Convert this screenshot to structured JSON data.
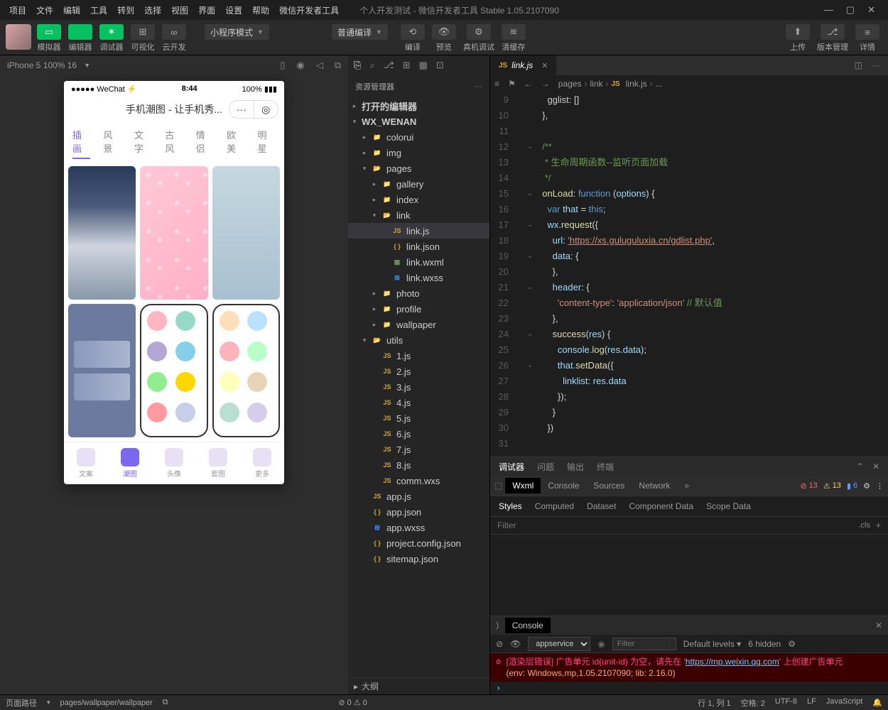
{
  "menu": [
    "项目",
    "文件",
    "编辑",
    "工具",
    "转到",
    "选择",
    "视图",
    "界面",
    "设置",
    "帮助",
    "微信开发者工具"
  ],
  "windowTitle": "个人开发测试 - 微信开发者工具 Stable 1.05.2107090",
  "toolbar": {
    "left": [
      {
        "icon": "▭",
        "label": "模拟器",
        "cls": "green"
      },
      {
        "icon": "</>",
        "label": "编辑器",
        "cls": "green"
      },
      {
        "icon": "✶",
        "label": "调试器",
        "cls": "green"
      },
      {
        "icon": "⊞",
        "label": "可视化",
        "cls": "gray"
      },
      {
        "icon": "∞",
        "label": "云开发",
        "cls": "gray"
      }
    ],
    "mode": "小程序模式",
    "compile": "普通编译",
    "mid": [
      {
        "icon": "⟲",
        "label": "编译"
      },
      {
        "icon": "👁",
        "label": "预览"
      },
      {
        "icon": "⚙",
        "label": "真机调试"
      },
      {
        "icon": "≋",
        "label": "清缓存"
      }
    ],
    "right": [
      {
        "icon": "⬆",
        "label": "上传"
      },
      {
        "icon": "⎇",
        "label": "版本管理"
      },
      {
        "icon": "≡",
        "label": "详情"
      }
    ]
  },
  "sim": {
    "device": "iPhone 5 100% 16",
    "status": {
      "l": "●●●●● WeChat ⚡",
      "c": "8:44",
      "r": "100% ▮▮▮"
    },
    "title": "手机潮图 - 让手机秀...",
    "tabs": [
      "插画",
      "风景",
      "文字",
      "古风",
      "情侣",
      "欧美",
      "明星"
    ],
    "nav": [
      "文案",
      "潮图",
      "头像",
      "套图",
      "更多"
    ]
  },
  "explorer": {
    "hdr": "资源管理器",
    "sections": [
      "打开的编辑器",
      "WX_WENAN"
    ],
    "tree": [
      {
        "d": 1,
        "t": "folder",
        "arr": "▸",
        "n": "colorui"
      },
      {
        "d": 1,
        "t": "folder-img",
        "arr": "▸",
        "n": "img"
      },
      {
        "d": 1,
        "t": "folder-open",
        "arr": "▾",
        "n": "pages"
      },
      {
        "d": 2,
        "t": "folder",
        "arr": "▸",
        "n": "gallery"
      },
      {
        "d": 2,
        "t": "folder",
        "arr": "▸",
        "n": "index"
      },
      {
        "d": 2,
        "t": "folder-open",
        "arr": "▾",
        "n": "link"
      },
      {
        "d": 3,
        "t": "js",
        "n": "link.js",
        "sel": true
      },
      {
        "d": 3,
        "t": "json",
        "n": "link.json"
      },
      {
        "d": 3,
        "t": "wxml",
        "n": "link.wxml"
      },
      {
        "d": 3,
        "t": "wxss",
        "n": "link.wxss"
      },
      {
        "d": 2,
        "t": "folder",
        "arr": "▸",
        "n": "photo"
      },
      {
        "d": 2,
        "t": "folder",
        "arr": "▸",
        "n": "profile"
      },
      {
        "d": 2,
        "t": "folder",
        "arr": "▸",
        "n": "wallpaper"
      },
      {
        "d": 1,
        "t": "folder-open",
        "arr": "▾",
        "n": "utils"
      },
      {
        "d": 2,
        "t": "js",
        "n": "1.js"
      },
      {
        "d": 2,
        "t": "js",
        "n": "2.js"
      },
      {
        "d": 2,
        "t": "js",
        "n": "3.js"
      },
      {
        "d": 2,
        "t": "js",
        "n": "4.js"
      },
      {
        "d": 2,
        "t": "js",
        "n": "5.js"
      },
      {
        "d": 2,
        "t": "js",
        "n": "6.js"
      },
      {
        "d": 2,
        "t": "js",
        "n": "7.js"
      },
      {
        "d": 2,
        "t": "js",
        "n": "8.js"
      },
      {
        "d": 2,
        "t": "wxs",
        "n": "comm.wxs"
      },
      {
        "d": 1,
        "t": "js",
        "n": "app.js"
      },
      {
        "d": 1,
        "t": "json",
        "n": "app.json"
      },
      {
        "d": 1,
        "t": "wxss",
        "n": "app.wxss"
      },
      {
        "d": 1,
        "t": "json",
        "n": "project.config.json"
      },
      {
        "d": 1,
        "t": "json",
        "n": "sitemap.json"
      }
    ],
    "outline": "大纲"
  },
  "editor": {
    "tab": "link.js",
    "crumb": [
      "pages",
      "link",
      "link.js",
      "..."
    ],
    "linesStart": 9,
    "code": [
      {
        "t": "    gglist<span class='o'>: []</span>"
      },
      {
        "t": "  <span class='o'>},</span>"
      },
      {
        "t": ""
      },
      {
        "t": "  <span class='c'>/**</span>",
        "fold": "⌄"
      },
      {
        "t": "<span class='c'>   * 生命周期函数--监听页面加载</span>"
      },
      {
        "t": "<span class='c'>   */</span>"
      },
      {
        "t": "  <span class='f'>onLoad</span><span class='o'>: </span><span class='b'>function</span> <span class='o'>(</span><span class='v'>options</span><span class='o'>) {</span>",
        "fold": "⌄"
      },
      {
        "t": "    <span class='b'>var</span> <span class='v'>that</span> <span class='o'>=</span> <span class='b'>this</span><span class='o'>;</span>"
      },
      {
        "t": "    <span class='v'>wx</span><span class='o'>.</span><span class='f'>request</span><span class='o'>({</span>",
        "fold": "⌄"
      },
      {
        "t": "      <span class='v'>url</span><span class='o'>: </span><span class='su'>'https://xs.guluguluxia.cn/gdlist.php'</span><span class='o'>,</span>"
      },
      {
        "t": "      <span class='v'>data</span><span class='o'>: {</span>",
        "fold": "⌄"
      },
      {
        "t": "      <span class='o'>},</span>"
      },
      {
        "t": "      <span class='v'>header</span><span class='o'>: {</span>",
        "fold": "⌄"
      },
      {
        "t": "        <span class='s'>'content-type'</span><span class='o'>: </span><span class='s'>'application/json'</span> <span class='c'>// 默认值</span>"
      },
      {
        "t": "      <span class='o'>},</span>"
      },
      {
        "t": "      <span class='f'>success</span><span class='o'>(</span><span class='v'>res</span><span class='o'>) {</span>",
        "fold": "⌄"
      },
      {
        "t": "        <span class='v'>console</span><span class='o'>.</span><span class='f'>log</span><span class='o'>(</span><span class='v'>res</span><span class='o'>.</span><span class='v'>data</span><span class='o'>);</span>"
      },
      {
        "t": "        <span class='v'>that</span><span class='o'>.</span><span class='f'>setData</span><span class='o'>({</span>",
        "fold": "⌄"
      },
      {
        "t": "          <span class='v'>linklist</span><span class='o'>: </span><span class='v'>res</span><span class='o'>.</span><span class='v'>data</span>"
      },
      {
        "t": "        <span class='o'>});</span>"
      },
      {
        "t": "      <span class='o'>}</span>"
      },
      {
        "t": "    <span class='o'>})</span>"
      },
      {
        "t": ""
      }
    ]
  },
  "panel": {
    "tabs": [
      "调试器",
      "问题",
      "输出",
      "终端"
    ],
    "devtabs": [
      "Wxml",
      "Console",
      "Sources",
      "Network"
    ],
    "badges": {
      "err": "13",
      "warn": "13",
      "info": "6"
    },
    "styletabs": [
      "Styles",
      "Computed",
      "Dataset",
      "Component Data",
      "Scope Data"
    ],
    "filterPh": "Filter",
    "cls": ".cls",
    "console": {
      "title": "Console",
      "ctx": "appservice",
      "filterPh": "Filter",
      "levels": "Default levels",
      "hidden": "6 hidden",
      "err1": "[渲染层错误] 广告单元 id(unit-id) 为空，请先在 '",
      "errUrl": "https://mp.weixin.qq.com",
      "err2": "' 上创建广告单元",
      "env": "(env: Windows,mp,1.05.2107090; lib: 2.16.0)"
    }
  },
  "status": {
    "l1": "页面路径",
    "l2": "pages/wallpaper/wallpaper",
    "mid": "⊘ 0 ⚠ 0",
    "r": [
      "行 1, 列 1",
      "空格: 2",
      "UTF-8",
      "LF",
      "JavaScript"
    ]
  }
}
